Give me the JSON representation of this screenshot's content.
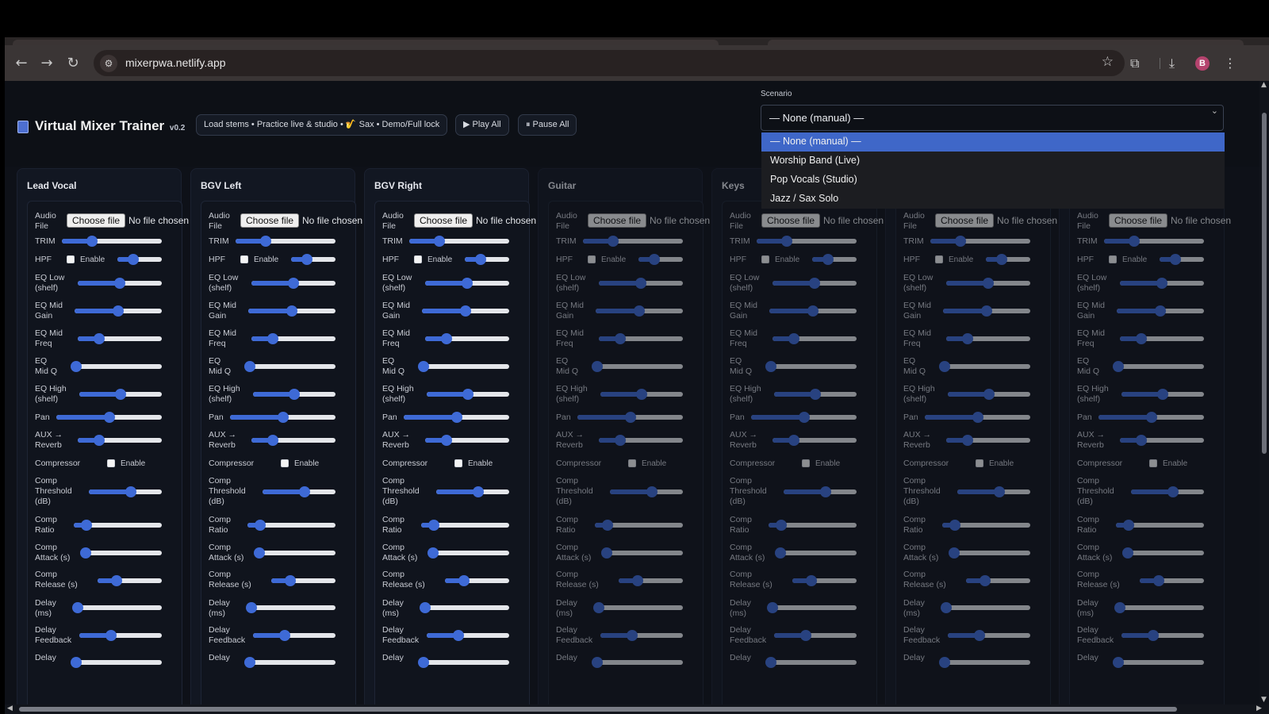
{
  "browser": {
    "url": "mixerpwa.netlify.app",
    "profile_initial": "B",
    "icons": [
      "back-icon",
      "forward-icon",
      "reload-icon",
      "site-settings-icon",
      "bookmark-star-icon",
      "extensions-icon",
      "download-icon",
      "more-menu-icon"
    ]
  },
  "header": {
    "title": "Virtual Mixer Trainer",
    "version": "v0.2",
    "info": "Load stems • Practice live & studio • 🎷 Sax • Demo/Full lock",
    "play_all": "▶ Play All",
    "pause_all": "⏸ Pause All"
  },
  "scenario": {
    "label": "Scenario",
    "selected": "— None (manual) —",
    "options": [
      "— None (manual) —",
      "Worship Band (Live)",
      "Pop Vocals (Studio)",
      "Jazz / Sax Solo"
    ]
  },
  "common": {
    "choose_file": "Choose file",
    "no_file": "No file chosen",
    "enable": "Enable"
  },
  "labels": {
    "audio": [
      "Audio",
      "File"
    ],
    "trim": "TRIM",
    "hpf": "HPF",
    "eq_low": [
      "EQ Low",
      "(shelf)"
    ],
    "eq_mid_gain": [
      "EQ Mid",
      "Gain"
    ],
    "eq_mid_freq": [
      "EQ Mid",
      "Freq"
    ],
    "eq_mid_q": [
      "EQ",
      "Mid Q"
    ],
    "eq_high": [
      "EQ High",
      "(shelf)"
    ],
    "pan": "Pan",
    "aux": [
      "AUX →",
      "Reverb"
    ],
    "compressor": "Compressor",
    "comp_threshold": [
      "Comp",
      "Threshold",
      "(dB)"
    ],
    "comp_ratio": [
      "Comp",
      "Ratio"
    ],
    "comp_attack": [
      "Comp",
      "Attack (s)"
    ],
    "comp_release": [
      "Comp",
      "Release (s)"
    ],
    "delay_ms": [
      "Delay",
      "(ms)"
    ],
    "delay_feedback": [
      "Delay",
      "Feedback"
    ],
    "delay_cut": "Delay"
  },
  "channels": [
    {
      "name": "Lead Vocal",
      "active": true
    },
    {
      "name": "BGV Left",
      "active": true
    },
    {
      "name": "BGV Right",
      "active": true
    },
    {
      "name": "Guitar",
      "active": false
    },
    {
      "name": "Keys",
      "active": false
    },
    {
      "name": "",
      "active": false
    },
    {
      "name": "",
      "active": false
    }
  ],
  "slider_levels": {
    "trim": 0.3,
    "hpf": 0.35,
    "eq_low": 0.5,
    "eq_mid_gain": 0.5,
    "eq_mid_freq": 0.25,
    "eq_mid_q": 0.05,
    "eq_high": 0.5,
    "pan": 0.5,
    "aux": 0.25,
    "comp_threshold": 0.58,
    "comp_ratio": 0.14,
    "comp_attack": 0.05,
    "comp_release": 0.3,
    "delay_ms": 0.02,
    "delay_feedback": 0.38,
    "delay_cut": 0.02
  }
}
